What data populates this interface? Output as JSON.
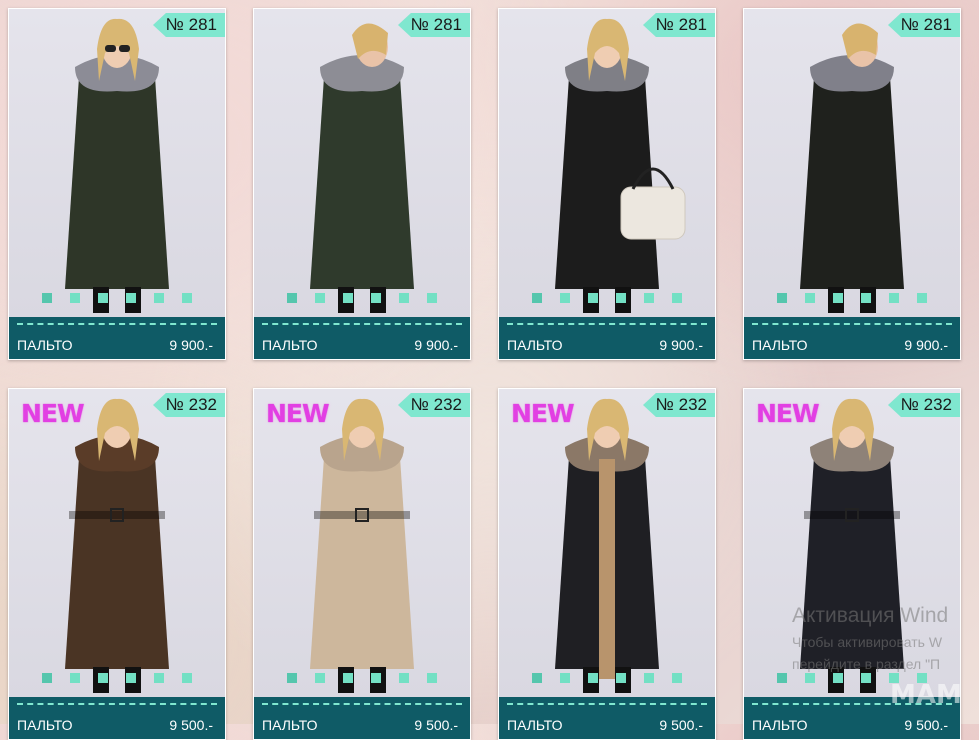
{
  "products": [
    {
      "number": "№ 281",
      "name": "ПАЛЬТО",
      "price": "9 900.-",
      "new": "",
      "coat": "#2e3628",
      "fur": "#8c8c96",
      "style": "front-glasses"
    },
    {
      "number": "№ 281",
      "name": "ПАЛЬТО",
      "price": "9 900.-",
      "new": "",
      "coat": "#2f3a2c",
      "fur": "#8d8d95",
      "style": "side"
    },
    {
      "number": "№ 281",
      "name": "ПАЛЬТО",
      "price": "9 900.-",
      "new": "",
      "coat": "#1c1c1c",
      "fur": "#7f7f86",
      "style": "front-bag"
    },
    {
      "number": "№ 281",
      "name": "ПАЛЬТО",
      "price": "9 900.-",
      "new": "",
      "coat": "#1f211d",
      "fur": "#80808a",
      "style": "side"
    },
    {
      "number": "№ 232",
      "name": "ПАЛЬТО",
      "price": "9 500.-",
      "new": "NEW",
      "coat": "#4a3424",
      "fur": "#5a3c28",
      "style": "belted"
    },
    {
      "number": "№ 232",
      "name": "ПАЛЬТО",
      "price": "9 500.-",
      "new": "NEW",
      "coat": "#cdb79c",
      "fur": "#b9a48d",
      "style": "belted"
    },
    {
      "number": "№ 232",
      "name": "ПАЛЬТО",
      "price": "9 500.-",
      "new": "NEW",
      "coat": "#1f1f23",
      "fur": "#8b7867",
      "style": "open"
    },
    {
      "number": "№ 232",
      "name": "ПАЛЬТО",
      "price": "9 500.-",
      "new": "NEW",
      "coat": "#1f2027",
      "fur": "#8e8278",
      "style": "belted"
    }
  ],
  "watermark": {
    "line1": "Активация Wind",
    "line2": "Чтобы активировать W",
    "line3": "перейдите в раздел \"П"
  },
  "logo": "МАМ",
  "colors": {
    "footer": "#0f5b66",
    "badge": "#7fe7cf",
    "new": "#e23fe3",
    "dot": "#73e0c4"
  }
}
